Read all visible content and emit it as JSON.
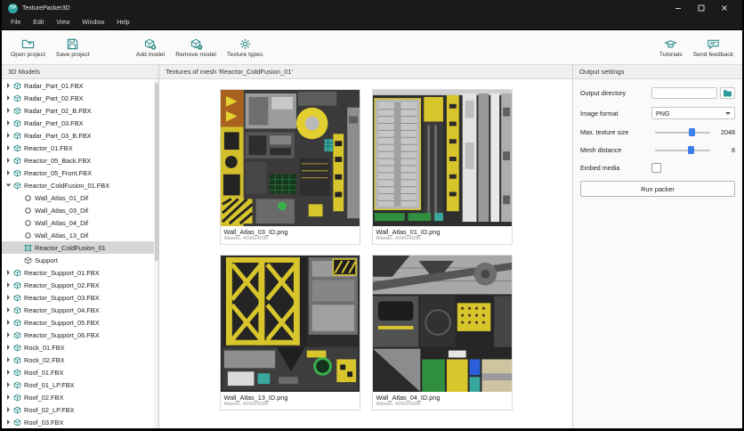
{
  "window": {
    "logo_text": "TP",
    "title": "TexturePacker3D"
  },
  "menu": {
    "items": [
      "File",
      "Edit",
      "View",
      "Window",
      "Help"
    ]
  },
  "toolbar": {
    "items": [
      {
        "label": "Open project"
      },
      {
        "label": "Save project"
      },
      {
        "label": "Add model"
      },
      {
        "label": "Remove model"
      },
      {
        "label": "Texture types"
      },
      {
        "label": "Tutorials"
      },
      {
        "label": "Send feedback"
      }
    ]
  },
  "sidebar": {
    "title": "3D Models",
    "items": [
      {
        "label": "Radar_Part_01.FBX",
        "type": "model"
      },
      {
        "label": "Radar_Part_02.FBX",
        "type": "model"
      },
      {
        "label": "Radar_Part_02_B.FBX",
        "type": "model"
      },
      {
        "label": "Radar_Part_03.FBX",
        "type": "model"
      },
      {
        "label": "Radar_Part_03_B.FBX",
        "type": "model"
      },
      {
        "label": "Reactor_01.FBX",
        "type": "model"
      },
      {
        "label": "Reactor_05_Back.FBX",
        "type": "model"
      },
      {
        "label": "Reactor_05_Front.FBX",
        "type": "model"
      },
      {
        "label": "Reactor_ColdFusion_01.FBX",
        "type": "model",
        "expanded": true
      },
      {
        "label": "Wall_Atlas_01_Dif",
        "type": "texture"
      },
      {
        "label": "Wall_Atlas_03_Dif",
        "type": "texture"
      },
      {
        "label": "Wall_Atlas_04_Dif",
        "type": "texture"
      },
      {
        "label": "Wall_Atlas_13_Dif",
        "type": "texture"
      },
      {
        "label": "Reactor_ColdFusion_01",
        "type": "mesh",
        "selected": true
      },
      {
        "label": "Support",
        "type": "support"
      },
      {
        "label": "Reactor_Support_01.FBX",
        "type": "model"
      },
      {
        "label": "Reactor_Support_02.FBX",
        "type": "model"
      },
      {
        "label": "Reactor_Support_03.FBX",
        "type": "model"
      },
      {
        "label": "Reactor_Support_04.FBX",
        "type": "model"
      },
      {
        "label": "Reactor_Support_05.FBX",
        "type": "model"
      },
      {
        "label": "Reactor_Support_06.FBX",
        "type": "model"
      },
      {
        "label": "Rock_01.FBX",
        "type": "model"
      },
      {
        "label": "Rock_02.FBX",
        "type": "model"
      },
      {
        "label": "Roof_01.FBX",
        "type": "model"
      },
      {
        "label": "Roof_01_LP.FBX",
        "type": "model"
      },
      {
        "label": "Roof_02.FBX",
        "type": "model"
      },
      {
        "label": "Roof_02_LP.FBX",
        "type": "model"
      },
      {
        "label": "Roof_03.FBX",
        "type": "model"
      }
    ]
  },
  "main": {
    "header": "Textures of mesh 'Reactor_ColdFusion_01'",
    "textures": [
      {
        "name": "Wall_Atlas_03_ID.png",
        "meta": "Albedo, 4096x4096"
      },
      {
        "name": "Wall_Atlas_01_ID.png",
        "meta": "Albedo, 4096x4096"
      },
      {
        "name": "Wall_Atlas_13_ID.png",
        "meta": "Albedo, 4096x4096"
      },
      {
        "name": "Wall_Atlas_04_ID.png",
        "meta": "Albedo, 4096x4096"
      }
    ]
  },
  "output": {
    "title": "Output settings",
    "output_directory": {
      "label": "Output directory",
      "value": ""
    },
    "image_format": {
      "label": "Image format",
      "value": "PNG"
    },
    "max_texture_size": {
      "label": "Max. texture size",
      "value": "2048"
    },
    "mesh_distance": {
      "label": "Mesh distance",
      "value": "8"
    },
    "embed_media": {
      "label": "Embed media",
      "checked": false
    },
    "run_packer_label": "Run packer"
  },
  "colors": {
    "accent_teal": "#2e8b8b",
    "slider_blue": "#3f7fe8",
    "selection_gray": "#d6d6d6"
  }
}
